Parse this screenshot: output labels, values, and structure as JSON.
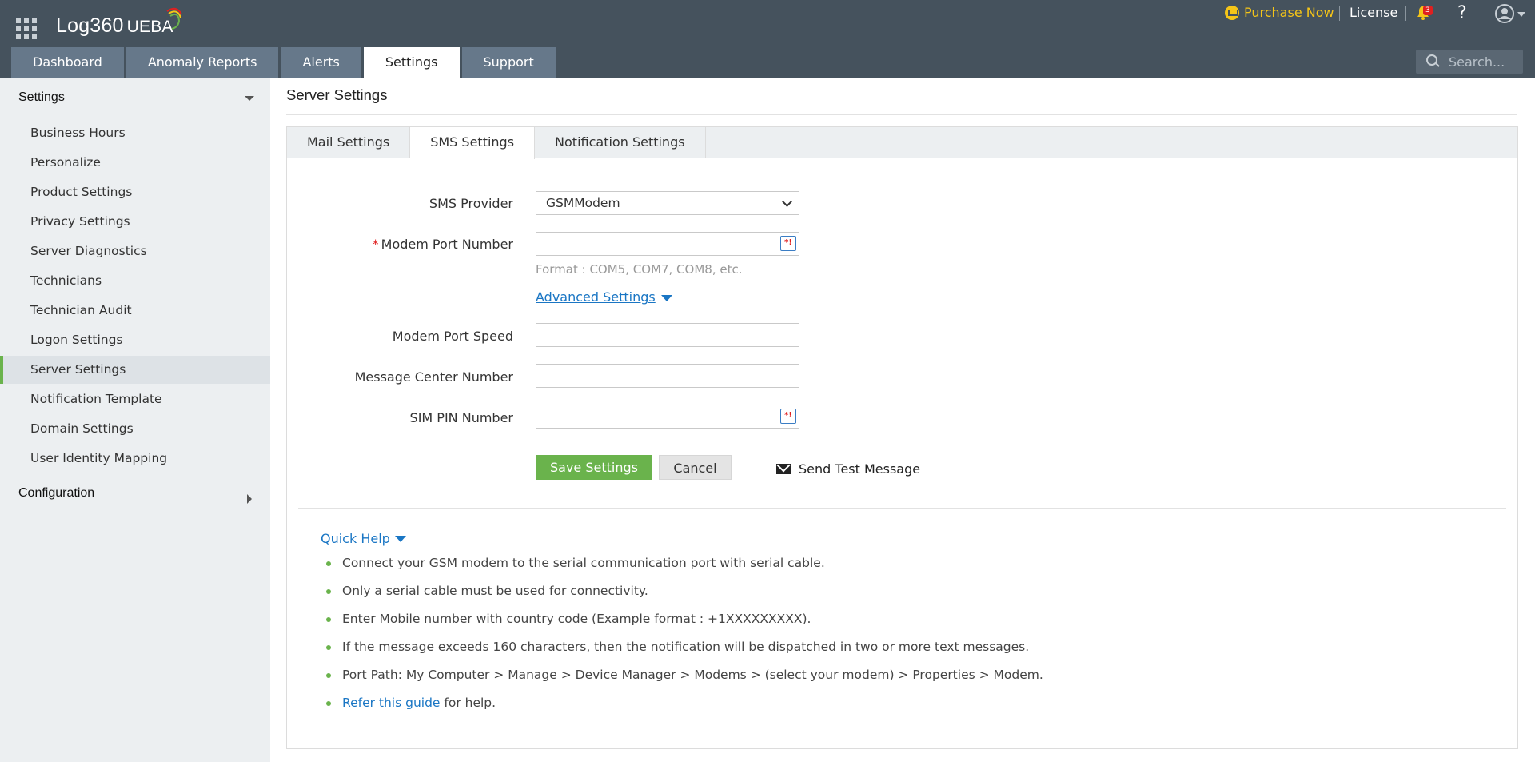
{
  "header": {
    "app_name": "Log360",
    "app_suffix": "UEBA",
    "purchase": "Purchase Now",
    "license": "License",
    "notification_count": "3",
    "help": "?",
    "search_placeholder": "Search..."
  },
  "nav": {
    "tabs": [
      {
        "label": "Dashboard"
      },
      {
        "label": "Anomaly Reports"
      },
      {
        "label": "Alerts"
      },
      {
        "label": "Settings",
        "active": true
      },
      {
        "label": "Support"
      }
    ]
  },
  "sidebar": {
    "section_settings": "Settings",
    "items": [
      {
        "label": "Business Hours"
      },
      {
        "label": "Personalize"
      },
      {
        "label": "Product Settings"
      },
      {
        "label": "Privacy Settings"
      },
      {
        "label": "Server Diagnostics"
      },
      {
        "label": "Technicians"
      },
      {
        "label": "Technician Audit"
      },
      {
        "label": "Logon Settings"
      },
      {
        "label": "Server Settings",
        "active": true
      },
      {
        "label": "Notification Template"
      },
      {
        "label": "Domain Settings"
      },
      {
        "label": "User Identity Mapping"
      }
    ],
    "section_configuration": "Configuration"
  },
  "main": {
    "title": "Server Settings",
    "subtabs": [
      {
        "label": "Mail Settings"
      },
      {
        "label": "SMS Settings",
        "active": true
      },
      {
        "label": "Notification Settings"
      }
    ],
    "form": {
      "sms_provider_label": "SMS Provider",
      "sms_provider_value": "GSMModem",
      "required_mark": "*",
      "modem_port_label": "Modem Port Number",
      "modem_port_value": "",
      "format_hint": "Format : COM5, COM7, COM8, etc.",
      "advanced_settings": "Advanced Settings",
      "port_speed_label": "Modem Port Speed",
      "port_speed_value": "",
      "message_center_label": "Message Center Number",
      "message_center_value": "",
      "sim_pin_label": "SIM PIN Number",
      "sim_pin_value": "",
      "password_icon_text": "*!",
      "save_button": "Save Settings",
      "cancel_button": "Cancel",
      "send_test": "Send Test Message"
    },
    "quick_help": {
      "title": "Quick Help",
      "items": [
        "Connect your GSM modem to the serial communication port with serial cable.",
        "Only a serial cable must be used for connectivity.",
        "Enter Mobile number with country code (Example format : +1XXXXXXXXX).",
        "If the message exceeds 160 characters, then the notification will be dispatched in two or more text messages.",
        "Port Path: My Computer > Manage > Device Manager > Modems > (select your modem) > Properties > Modem."
      ],
      "last_link": "Refer this guide",
      "last_suffix": " for help."
    }
  },
  "colors": {
    "header_bg": "#45525d",
    "tab_bg": "#66788a",
    "accent_green": "#6ab34c",
    "link_blue": "#1a76c4",
    "purchase_yellow": "#f5c518",
    "badge_red": "#e02020"
  },
  "icons": [
    "app-grid-icon",
    "logo-arc-icon",
    "cart-icon",
    "bell-icon",
    "help-icon",
    "user-icon",
    "search-icon",
    "chevron-down-icon",
    "password-hint-icon",
    "mail-icon"
  ]
}
